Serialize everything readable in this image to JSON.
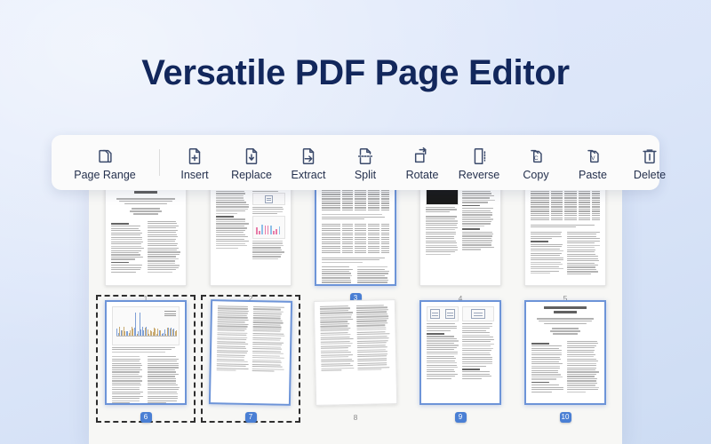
{
  "headline": "Versatile PDF Page Editor",
  "colors": {
    "background_top": "#e2eafb",
    "background_bottom": "#cddcf3",
    "headline": "#12275c",
    "toolbar_bg": "#fbfbfb",
    "icon": "#3b4a6b",
    "selection_border": "#6d94d8",
    "badge_active": "#4a7fd4",
    "panel_bg": "#f7f7f5"
  },
  "toolbar": {
    "items": [
      {
        "id": "page-range",
        "label": "Page Range",
        "icon": "stacked-pages-icon"
      },
      {
        "id": "insert",
        "label": "Insert",
        "icon": "page-plus-icon"
      },
      {
        "id": "replace",
        "label": "Replace",
        "icon": "page-replace-icon"
      },
      {
        "id": "extract",
        "label": "Extract",
        "icon": "page-arrow-right-icon"
      },
      {
        "id": "split",
        "label": "Split",
        "icon": "page-split-dashed-icon"
      },
      {
        "id": "rotate",
        "label": "Rotate",
        "icon": "page-rotate-icon"
      },
      {
        "id": "reverse",
        "label": "Reverse",
        "icon": "page-reverse-icon"
      },
      {
        "id": "copy",
        "label": "Copy",
        "icon": "copy-c-icon"
      },
      {
        "id": "paste",
        "label": "Paste",
        "icon": "paste-v-icon"
      },
      {
        "id": "delete",
        "label": "Delete",
        "icon": "trash-icon"
      }
    ]
  },
  "pages": [
    {
      "number": "1",
      "selected": false,
      "kind": "title-page",
      "dropzone": false
    },
    {
      "number": "2",
      "selected": false,
      "kind": "text-figures",
      "dropzone": false
    },
    {
      "number": "3",
      "selected": true,
      "kind": "tables-text",
      "dropzone": false
    },
    {
      "number": "4",
      "selected": false,
      "kind": "dark-figure",
      "dropzone": false
    },
    {
      "number": "5",
      "selected": false,
      "kind": "table-text",
      "dropzone": false
    },
    {
      "number": "6",
      "selected": true,
      "kind": "bar-chart",
      "dropzone": true
    },
    {
      "number": "7",
      "selected": true,
      "kind": "two-column",
      "dropzone": true
    },
    {
      "number": "8",
      "selected": false,
      "kind": "two-column",
      "dropzone": false
    },
    {
      "number": "9",
      "selected": true,
      "kind": "diagrams",
      "dropzone": false
    },
    {
      "number": "10",
      "selected": true,
      "kind": "title-page",
      "dropzone": false
    }
  ],
  "document": {
    "page1_title": "Languages",
    "page10_title": "Trace-based Just-in-Time Type Specialization for Dynamic Languages"
  }
}
